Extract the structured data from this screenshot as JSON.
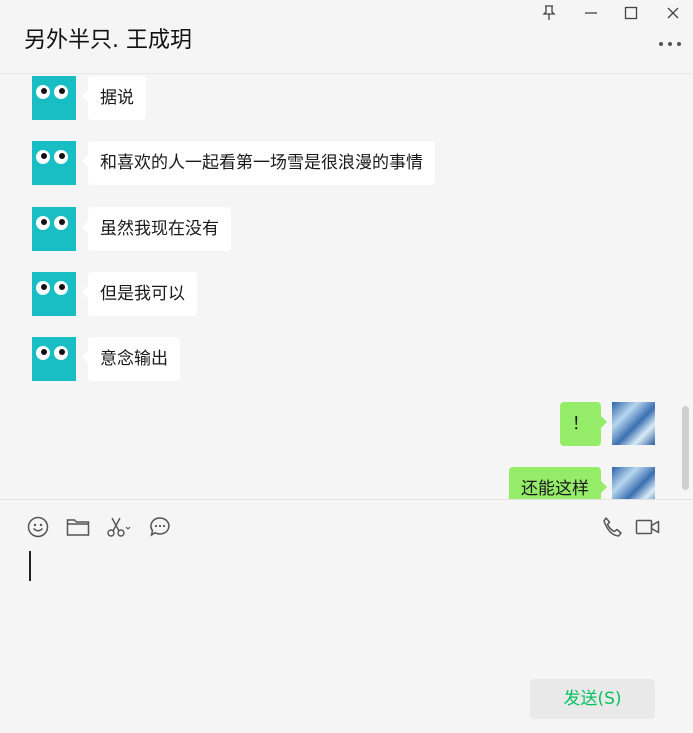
{
  "window": {
    "title": "另外半只. 王成玥",
    "pin_icon": "pin-icon",
    "minimize_icon": "minimize-icon",
    "maximize_icon": "maximize-icon",
    "close_icon": "close-icon",
    "more_icon": "more-icon"
  },
  "messages": [
    {
      "side": "in",
      "text": "据说"
    },
    {
      "side": "in",
      "text": "和喜欢的人一起看第一场雪是很浪漫的事情"
    },
    {
      "side": "in",
      "text": "虽然我现在没有"
    },
    {
      "side": "in",
      "text": "但是我可以"
    },
    {
      "side": "in",
      "text": "意念输出"
    },
    {
      "side": "out",
      "text": "！"
    },
    {
      "side": "out",
      "text": "还能这样"
    }
  ],
  "toolbar": {
    "icons": [
      "emoji-icon",
      "folder-icon",
      "scissors-icon",
      "chat-history-icon",
      "phone-icon",
      "video-icon"
    ],
    "send_label": "发送(S)"
  },
  "colors": {
    "accent": "#07c160",
    "outgoing_bubble": "#95ec69",
    "incoming_bubble": "#ffffff",
    "avatar": "#19bec4",
    "background": "#f5f5f5"
  }
}
